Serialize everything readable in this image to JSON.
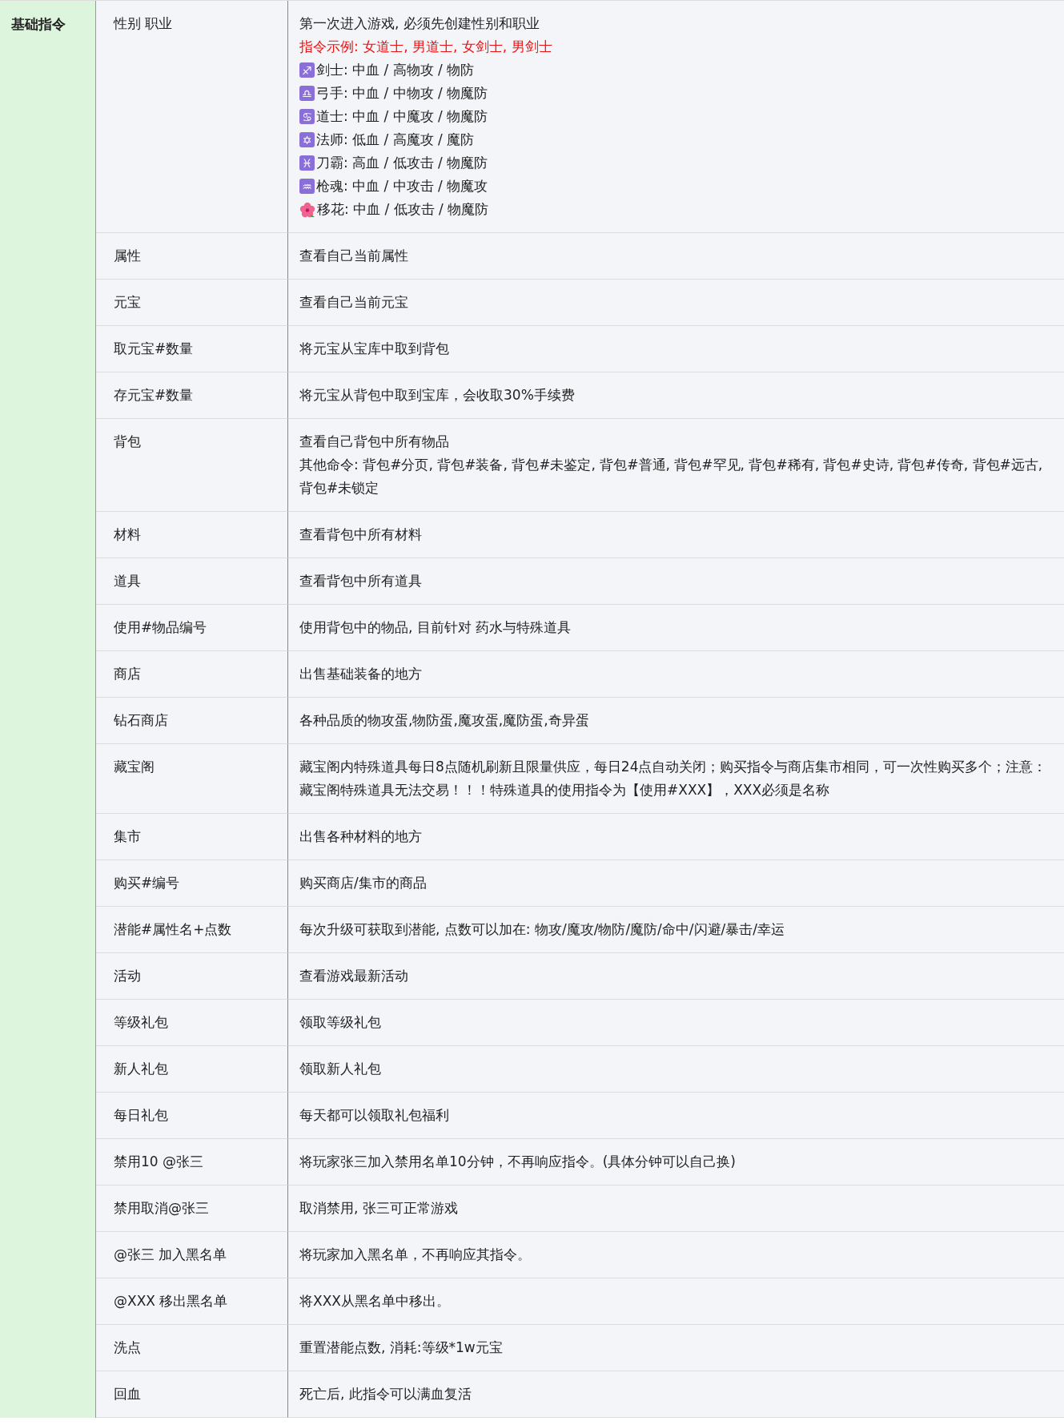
{
  "category": "基础指令",
  "rows": [
    {
      "command": "性别 职业",
      "lines": [
        {
          "kind": "text",
          "text": "第一次进入游戏, 必须先创建性别和职业"
        },
        {
          "kind": "note",
          "text": "指令示例: 女道士, 男道士, 女剑士, 男剑士"
        },
        {
          "kind": "symbol",
          "symbol": "♐",
          "text": "剑士: 中血 / 高物攻 / 物防"
        },
        {
          "kind": "symbol",
          "symbol": "♎",
          "text": "弓手: 中血 / 中物攻 / 物魔防"
        },
        {
          "kind": "symbol",
          "symbol": "♋",
          "text": "道士: 中血 / 中魔攻 / 物魔防"
        },
        {
          "kind": "symbol",
          "symbol": "✡",
          "text": "法师: 低血 / 高魔攻 / 魔防"
        },
        {
          "kind": "symbol",
          "symbol": "♓",
          "text": "刀霸: 高血 / 低攻击 / 物魔防"
        },
        {
          "kind": "symbol",
          "symbol": "♒",
          "text": "枪魂: 中血 / 中攻击 / 物魔攻"
        },
        {
          "kind": "flower",
          "text": "移花: 中血 / 低攻击 / 物魔防"
        }
      ]
    },
    {
      "command": "属性",
      "lines": [
        {
          "kind": "text",
          "text": "查看自己当前属性"
        }
      ]
    },
    {
      "command": "元宝",
      "lines": [
        {
          "kind": "text",
          "text": "查看自己当前元宝"
        }
      ]
    },
    {
      "command": "取元宝#数量",
      "lines": [
        {
          "kind": "text",
          "text": "将元宝从宝库中取到背包"
        }
      ]
    },
    {
      "command": "存元宝#数量",
      "lines": [
        {
          "kind": "text",
          "text": "将元宝从背包中取到宝库，会收取30%手续费"
        }
      ]
    },
    {
      "command": "背包",
      "lines": [
        {
          "kind": "text",
          "text": "查看自己背包中所有物品"
        },
        {
          "kind": "text",
          "text": "其他命令: 背包#分页, 背包#装备, 背包#未鉴定, 背包#普通, 背包#罕见, 背包#稀有, 背包#史诗, 背包#传奇, 背包#远古, 背包#未锁定"
        }
      ]
    },
    {
      "command": "材料",
      "lines": [
        {
          "kind": "text",
          "text": "查看背包中所有材料"
        }
      ]
    },
    {
      "command": "道具",
      "lines": [
        {
          "kind": "text",
          "text": "查看背包中所有道具"
        }
      ]
    },
    {
      "command": "使用#物品编号",
      "lines": [
        {
          "kind": "text",
          "text": "使用背包中的物品, 目前针对 药水与特殊道具"
        }
      ]
    },
    {
      "command": "商店",
      "lines": [
        {
          "kind": "text",
          "text": "出售基础装备的地方"
        }
      ]
    },
    {
      "command": "钻石商店",
      "lines": [
        {
          "kind": "text",
          "text": "各种品质的物攻蛋,物防蛋,魔攻蛋,魔防蛋,奇异蛋"
        }
      ]
    },
    {
      "command": "藏宝阁",
      "lines": [
        {
          "kind": "text",
          "text": "藏宝阁内特殊道具每日8点随机刷新且限量供应，每日24点自动关闭；购买指令与商店集市相同，可一次性购买多个；注意：藏宝阁特殊道具无法交易！！！特殊道具的使用指令为【使用#XXX】，XXX必须是名称"
        }
      ]
    },
    {
      "command": "集市",
      "lines": [
        {
          "kind": "text",
          "text": "出售各种材料的地方"
        }
      ]
    },
    {
      "command": "购买#编号",
      "lines": [
        {
          "kind": "text",
          "text": "购买商店/集市的商品"
        }
      ]
    },
    {
      "command": "潜能#属性名+点数",
      "lines": [
        {
          "kind": "text",
          "text": "每次升级可获取到潜能, 点数可以加在: 物攻/魔攻/物防/魔防/命中/闪避/暴击/幸运"
        }
      ]
    },
    {
      "command": "活动",
      "lines": [
        {
          "kind": "text",
          "text": "查看游戏最新活动"
        }
      ]
    },
    {
      "command": "等级礼包",
      "lines": [
        {
          "kind": "text",
          "text": "领取等级礼包"
        }
      ]
    },
    {
      "command": "新人礼包",
      "lines": [
        {
          "kind": "text",
          "text": "领取新人礼包"
        }
      ]
    },
    {
      "command": "每日礼包",
      "lines": [
        {
          "kind": "text",
          "text": "每天都可以领取礼包福利"
        }
      ]
    },
    {
      "command": "禁用10 @张三",
      "lines": [
        {
          "kind": "text",
          "text": "将玩家张三加入禁用名单10分钟，不再响应指令。(具体分钟可以自己换)"
        }
      ]
    },
    {
      "command": "禁用取消@张三",
      "lines": [
        {
          "kind": "text",
          "text": "取消禁用, 张三可正常游戏"
        }
      ]
    },
    {
      "command": "@张三 加入黑名单",
      "lines": [
        {
          "kind": "text",
          "text": "将玩家加入黑名单，不再响应其指令。"
        }
      ]
    },
    {
      "command": "@XXX 移出黑名单",
      "lines": [
        {
          "kind": "text",
          "text": "将XXX从黑名单中移出。"
        }
      ]
    },
    {
      "command": "洗点",
      "lines": [
        {
          "kind": "text",
          "text": "重置潜能点数, 消耗:等级*1w元宝"
        }
      ]
    },
    {
      "command": "回血",
      "lines": [
        {
          "kind": "text",
          "text": "死亡后, 此指令可以满血复活"
        }
      ]
    }
  ]
}
